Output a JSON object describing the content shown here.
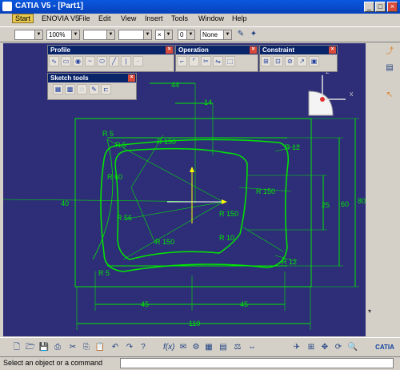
{
  "window": {
    "title": "CATIA V5 - [Part1]",
    "controls": {
      "minimize": "_",
      "maximize": "□",
      "close": "×"
    }
  },
  "menubar": {
    "items": [
      "Start",
      "ENOVIA V5",
      "File",
      "Edit",
      "View",
      "Insert",
      "Tools",
      "Window",
      "Help"
    ]
  },
  "toolbar": {
    "color_combo": "",
    "transparency_combo": "100%",
    "linetype_combo": "",
    "thickness_combo": "",
    "point_combo": "×",
    "layer_prefix": "0",
    "layer_combo": "None"
  },
  "palettes": {
    "profile": {
      "title": "Profile"
    },
    "operation": {
      "title": "Operation"
    },
    "constraint": {
      "title": "Constraint"
    },
    "sketch_tools": {
      "title": "Sketch tools"
    }
  },
  "compass": {
    "z": "z",
    "x": "x"
  },
  "dimensions": {
    "d44": "44",
    "d14": "14",
    "r5_top": "R 5",
    "r5_top2": "R 5",
    "r150_top": "R 150",
    "r12_top": "R 12",
    "r60": "R 60",
    "d40": "40",
    "r150_right": "R 150",
    "r150_right2": "R 150",
    "d25": "25",
    "d60": "60",
    "d80": "80",
    "r56": "R 56",
    "r150_bottom": "R 150",
    "r5_bottom": "R 5",
    "r12_bottom": "R 12",
    "r10": "R 10",
    "d45_left": "45",
    "d45_right": "45",
    "d110": "110"
  },
  "status": {
    "message": "Select an object or a command"
  },
  "colors": {
    "background": "#2e2d78",
    "geometry": "#00ff00",
    "axis_h": "#ffffff",
    "axis_v": "#ffff00"
  }
}
